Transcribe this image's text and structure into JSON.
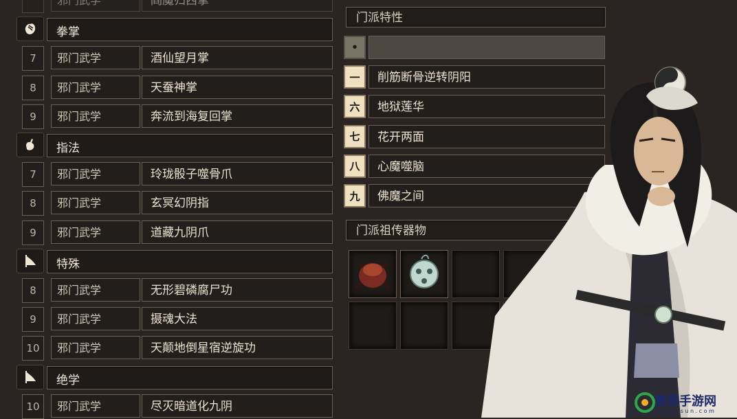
{
  "left_list": [
    {
      "kind": "skill",
      "level": "",
      "type": "邪门武学",
      "name": "阎魔归西掌",
      "top": true
    },
    {
      "kind": "category",
      "icon": "palm-icon",
      "label": "拳掌"
    },
    {
      "kind": "skill",
      "level": "7",
      "type": "邪门武学",
      "name": "酒仙望月掌"
    },
    {
      "kind": "skill",
      "level": "8",
      "type": "邪门武学",
      "name": "天蚕神掌"
    },
    {
      "kind": "skill",
      "level": "9",
      "type": "邪门武学",
      "name": "奔流到海复回掌"
    },
    {
      "kind": "category",
      "icon": "finger-icon",
      "label": "指法"
    },
    {
      "kind": "skill",
      "level": "7",
      "type": "邪门武学",
      "name": "玲珑骰子噬骨爪"
    },
    {
      "kind": "skill",
      "level": "8",
      "type": "邪门武学",
      "name": "玄冥幻阴指"
    },
    {
      "kind": "skill",
      "level": "9",
      "type": "邪门武学",
      "name": "道藏九阴爪"
    },
    {
      "kind": "category",
      "icon": "flag-icon",
      "label": "特殊"
    },
    {
      "kind": "skill",
      "level": "8",
      "type": "邪门武学",
      "name": "无形碧磷腐尸功"
    },
    {
      "kind": "skill",
      "level": "9",
      "type": "邪门武学",
      "name": "摄魂大法"
    },
    {
      "kind": "skill",
      "level": "10",
      "type": "邪门武学",
      "name": "天颠地倒星宿逆旋功"
    },
    {
      "kind": "category",
      "icon": "flag-icon",
      "label": "绝学"
    },
    {
      "kind": "skill",
      "level": "10",
      "type": "邪门武学",
      "name": "尽灭暗道化九阴"
    }
  ],
  "traits_header": "门派特性",
  "traits": [
    {
      "num": "•",
      "label": "",
      "dim": true
    },
    {
      "num": "一",
      "label": "削筋断骨逆转阴阳"
    },
    {
      "num": "六",
      "label": "地狱莲华"
    },
    {
      "num": "七",
      "label": "花开两面"
    },
    {
      "num": "八",
      "label": "心魔噬脑"
    },
    {
      "num": "九",
      "label": "佛魔之间"
    }
  ],
  "relics_header": "门派祖传器物",
  "relic_slots": [
    {
      "item": "red-beetle-icon"
    },
    {
      "item": "jade-orb-icon"
    },
    {
      "item": ""
    },
    {
      "item": ""
    },
    {
      "item": ""
    },
    {
      "item": ""
    },
    {
      "item": ""
    },
    {
      "item": ""
    },
    {
      "item": ""
    },
    {
      "item": ""
    }
  ],
  "watermark": {
    "text": "寰晟手游网",
    "url": "h u a n - s u n . c o m"
  },
  "colors": {
    "bg": "#2a2522",
    "border": "#6a6053",
    "text": "#ece3cf",
    "trait_num_bg": "#efe1c0"
  }
}
